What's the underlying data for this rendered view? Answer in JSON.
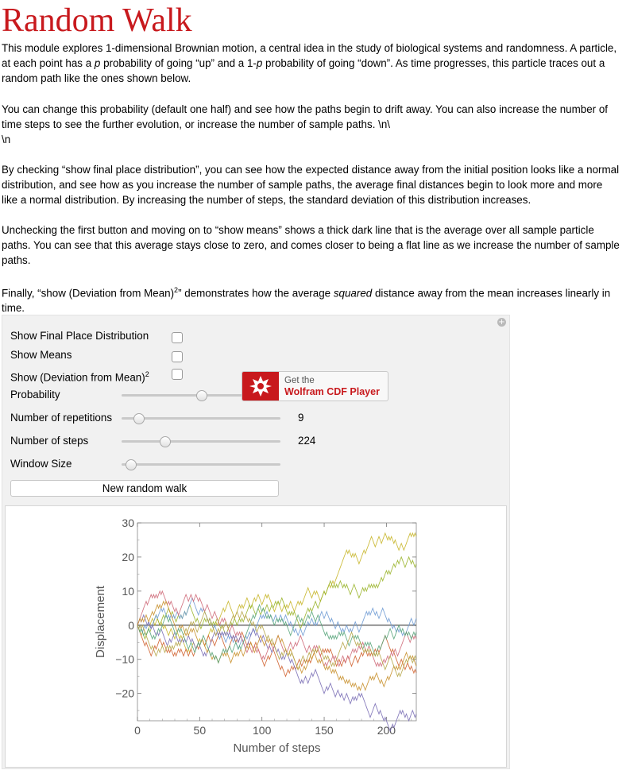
{
  "page": {
    "title": "Random Walk",
    "para1_a": "This module explores 1-dimensional Brownian motion, a central idea in the study of biological systems and randomness. A particle, at each point has a ",
    "para1_p": "p",
    "para1_b": " probability of going “up” and a 1-",
    "para1_p2": "p",
    "para1_c": " probability of going “down”. As time progresses, this particle traces out a random path like the ones shown below.",
    "para2": "You can change this probability (default one half) and see how the paths begin to drift away. You can also increase the number of time steps to see the further evolution, or increase the number of sample paths. \\n\\",
    "para2_esc": "\\n",
    "para3": "By checking “show final place distribution”, you can see how the expected distance away from the initial position looks like a normal distribution, and see how as you increase the number of sample paths, the average final distances begin to look more and more like a normal distribution. By increasing the number of steps, the standard deviation of this distribution increases.",
    "para4": "Unchecking the first button and moving on to “show means” shows a thick dark line that is the average over all sample particle paths. You can see that this average stays close to zero, and comes closer to being a flat line as we increase the number of sample paths.",
    "para5_a": "Finally, “show (Deviation from Mean)",
    "para5_sup": "2",
    "para5_b": "” demonstrates how the average ",
    "para5_em": "squared",
    "para5_c": " distance away from the mean increases linearly in time."
  },
  "controls": {
    "show_final_label": "Show Final Place Distribution",
    "show_means_label": "Show Means",
    "show_dev_label": "Show (Deviation from Mean)",
    "show_dev_sup": "2",
    "probability_label": "Probability",
    "probability_value": 0.5,
    "repetitions_label": "Number of repetitions",
    "repetitions_value": "9",
    "steps_label": "Number of steps",
    "steps_value": "224",
    "window_label": "Window Size",
    "new_walk_label": "New random walk",
    "cdf_get": "Get the",
    "cdf_name": "Wolfram CDF Player",
    "show_final_checked": false,
    "show_means_checked": false,
    "show_dev_checked": false
  },
  "chart_data": {
    "type": "line",
    "xlabel": "Number of steps",
    "ylabel": "Displacement",
    "xlim": [
      0,
      224
    ],
    "ylim": [
      -28,
      30
    ],
    "xticks": [
      "0",
      "50",
      "100",
      "150",
      "200"
    ],
    "yticks": [
      "30",
      "20",
      "10",
      "0",
      "−10",
      "−20"
    ],
    "steps": 224,
    "series_count": 9,
    "series": [
      {
        "color": "#c8b62a",
        "end": 25
      },
      {
        "color": "#9bb52e",
        "end": 17
      },
      {
        "color": "#6f9bd4",
        "end": 2
      },
      {
        "color": "#d0622f",
        "end": -15
      },
      {
        "color": "#7b6fb6",
        "end": -26
      },
      {
        "color": "#cf6b7a",
        "end": -5
      },
      {
        "color": "#c9912e",
        "end": -12
      },
      {
        "color": "#5aa67c",
        "end": -3
      },
      {
        "color": "#b7a64a",
        "end": -10
      }
    ]
  }
}
